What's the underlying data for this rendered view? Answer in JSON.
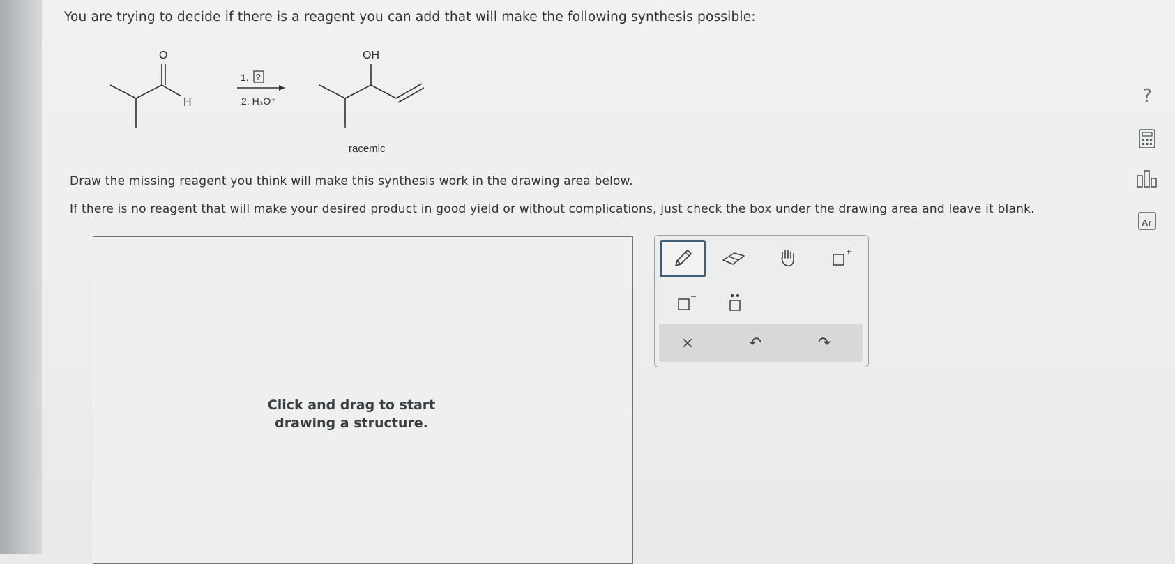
{
  "question": {
    "text": "You are trying to decide if there is a reagent you can add that will make the following synthesis possible:"
  },
  "reaction": {
    "reactant": {
      "oxygen_label": "O",
      "h_label": "H"
    },
    "arrow": {
      "step1": "1.",
      "unknown": "?",
      "step2": "2. H₃O⁺"
    },
    "product": {
      "oh_label": "OH",
      "note": "racemic"
    }
  },
  "instructions": {
    "line1": "Draw the missing reagent you think will make this synthesis work in the drawing area below.",
    "line2": "If there is no reagent that will make your desired product in good yield or without complications, just check the box under the drawing area and leave it blank."
  },
  "drawing_area": {
    "hint": "Click and drag to start drawing a structure."
  },
  "toolbox": {
    "tools": [
      {
        "name": "pencil-icon",
        "selected": true
      },
      {
        "name": "eraser-icon",
        "selected": false
      },
      {
        "name": "hand-icon",
        "selected": false
      },
      {
        "name": "positive-charge-icon",
        "selected": false
      },
      {
        "name": "negative-charge-icon",
        "selected": false
      },
      {
        "name": "lone-pair-icon",
        "selected": false
      }
    ],
    "bottom": {
      "clear": "×",
      "undo": "↶",
      "redo": "↷"
    }
  },
  "side_panel": {
    "help": "?",
    "icons": [
      "calculator-icon",
      "bar-chart-icon",
      "periodic-table-icon"
    ],
    "periodic_label": "Ar"
  },
  "colors": {
    "selected_border": "#3f5f78",
    "text": "#2f3236"
  }
}
